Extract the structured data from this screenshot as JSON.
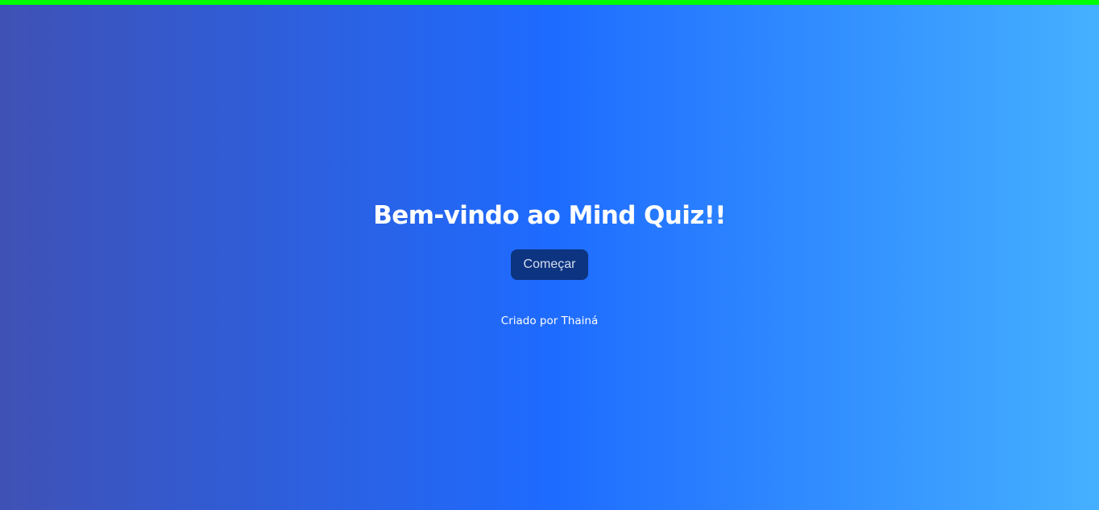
{
  "colors": {
    "top_bar": "#00ff00",
    "gradient_start": "#3f51b5",
    "gradient_mid": "#1e6bff",
    "gradient_end": "#45b0ff",
    "button_bg": "#0d3480",
    "title_text": "#ffffff",
    "button_text": "#d6def0"
  },
  "welcome": {
    "title": "Bem-vindo ao Mind Quiz!!",
    "start_button_label": "Começar",
    "credits": "Criado por Thainá"
  }
}
